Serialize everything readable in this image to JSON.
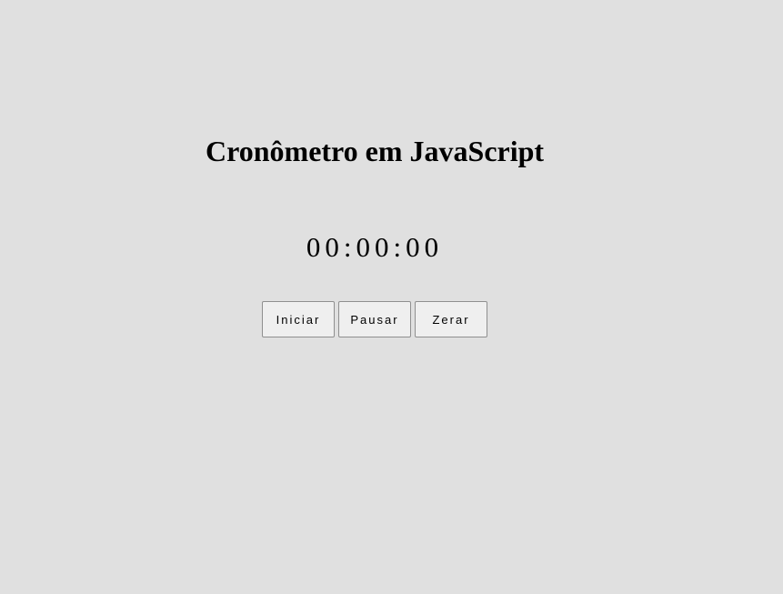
{
  "page": {
    "title": "Cronômetro em JavaScript"
  },
  "timer": {
    "display": "00:00:00"
  },
  "controls": {
    "start_label": "Iniciar",
    "pause_label": "Pausar",
    "reset_label": "Zerar"
  },
  "colors": {
    "background": "#e0e0e0",
    "text": "#000000",
    "button_background": "#efefef",
    "button_border": "#8f8f8f"
  }
}
